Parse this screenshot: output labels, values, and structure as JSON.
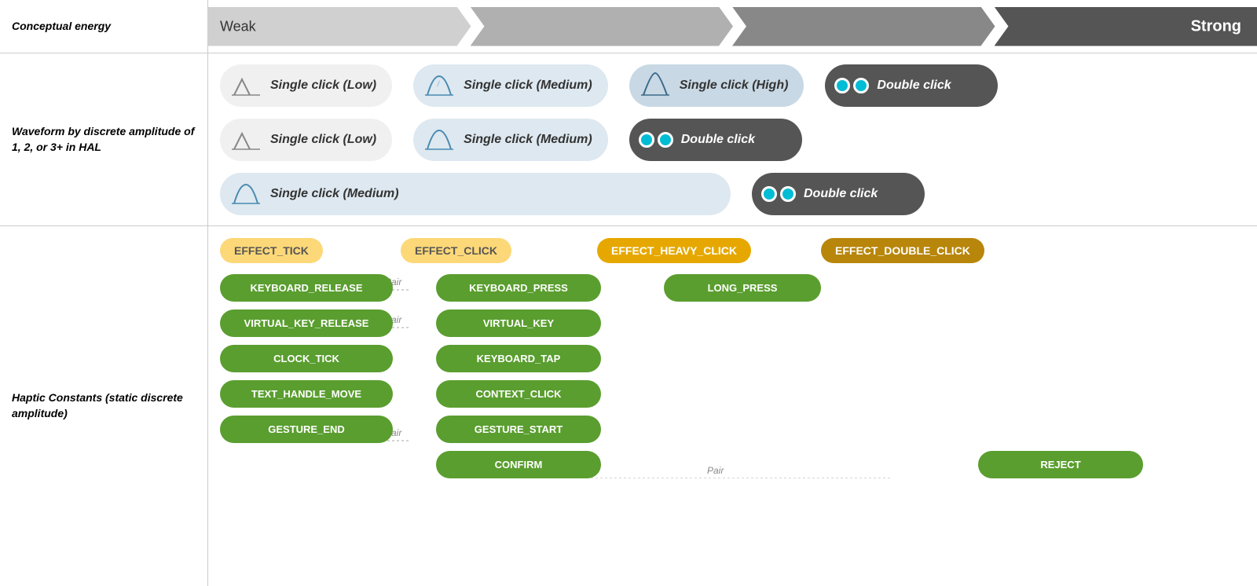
{
  "energy": {
    "label": "Conceptual energy",
    "weak": "Weak",
    "strong": "Strong"
  },
  "waveform": {
    "label": "Waveform by discrete amplitude of 1, 2, or 3+ in HAL",
    "row1": [
      {
        "type": "single",
        "level": "Low",
        "label": "Single click (Low)"
      },
      {
        "type": "single",
        "level": "Medium",
        "label": "Single click (Medium)"
      },
      {
        "type": "single",
        "level": "High",
        "label": "Single click (High)"
      },
      {
        "type": "double",
        "label": "Double click"
      }
    ],
    "row2": [
      {
        "type": "single",
        "level": "Low",
        "label": "Single click (Low)"
      },
      {
        "type": "single",
        "level": "Medium",
        "label": "Single click (Medium)"
      },
      {
        "type": "double",
        "label": "Double click"
      }
    ],
    "row3": [
      {
        "type": "single",
        "level": "Medium",
        "label": "Single click (Medium)"
      },
      {
        "type": "double",
        "label": "Double click"
      }
    ]
  },
  "haptic": {
    "label": "Haptic Constants (static discrete amplitude)",
    "effects": [
      {
        "label": "EFFECT_TICK",
        "color": "light-yellow"
      },
      {
        "label": "EFFECT_CLICK",
        "color": "light-yellow"
      },
      {
        "label": "EFFECT_HEAVY_CLICK",
        "color": "dark-yellow"
      },
      {
        "label": "EFFECT_DOUBLE_CLICK",
        "color": "brown"
      }
    ],
    "col1": [
      "KEYBOARD_RELEASE",
      "VIRTUAL_KEY_RELEASE",
      "CLOCK_TICK",
      "TEXT_HANDLE_MOVE",
      "GESTURE_END"
    ],
    "col2": [
      "KEYBOARD_PRESS",
      "VIRTUAL_KEY",
      "KEYBOARD_TAP",
      "CONTEXT_CLICK",
      "GESTURE_START",
      "CONFIRM"
    ],
    "col3": [
      "LONG_PRESS"
    ],
    "col4": [
      "REJECT"
    ],
    "pairs": [
      {
        "from": "KEYBOARD_RELEASE",
        "to": "KEYBOARD_PRESS",
        "label": "Pair"
      },
      {
        "from": "VIRTUAL_KEY_RELEASE",
        "to": "VIRTUAL_KEY",
        "label": "Pair"
      },
      {
        "from": "GESTURE_END",
        "to": "GESTURE_START",
        "label": "Pair"
      },
      {
        "from": "CONFIRM",
        "to": "REJECT",
        "label": "Pair"
      }
    ]
  }
}
